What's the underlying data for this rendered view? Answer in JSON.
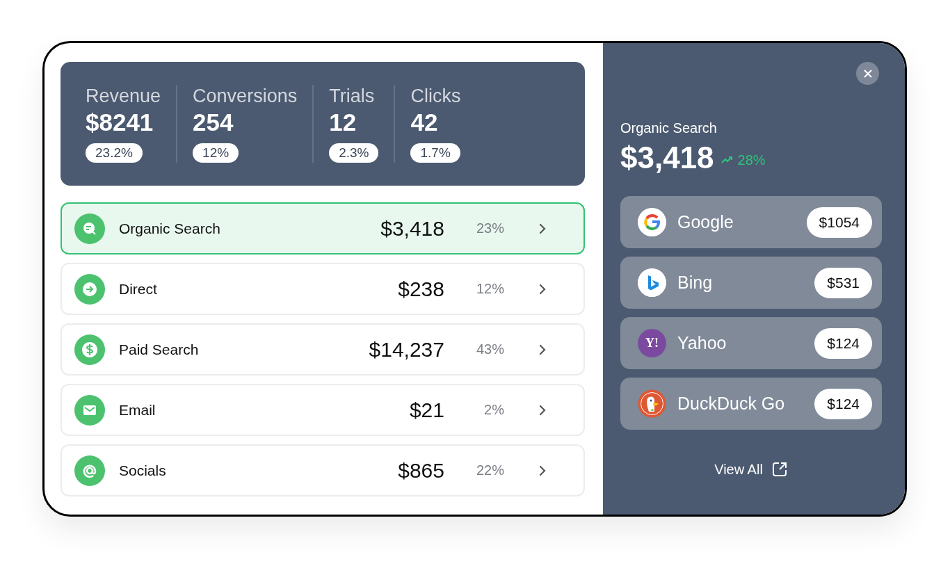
{
  "stats": [
    {
      "label": "Revenue",
      "value": "$8241",
      "change": "23.2%"
    },
    {
      "label": "Conversions",
      "value": "254",
      "change": "12%"
    },
    {
      "label": "Trials",
      "value": "12",
      "change": "2.3%"
    },
    {
      "label": "Clicks",
      "value": "42",
      "change": "1.7%"
    }
  ],
  "channels": [
    {
      "kind": "search",
      "name": "Organic Search",
      "amount": "$3,418",
      "share": "23%",
      "selected": true
    },
    {
      "kind": "direct",
      "name": "Direct",
      "amount": "$238",
      "share": "12%",
      "selected": false
    },
    {
      "kind": "dollar",
      "name": "Paid Search",
      "amount": "$14,237",
      "share": "43%",
      "selected": false
    },
    {
      "kind": "email",
      "name": "Email",
      "amount": "$21",
      "share": "2%",
      "selected": false
    },
    {
      "kind": "at",
      "name": "Socials",
      "amount": "$865",
      "share": "22%",
      "selected": false
    }
  ],
  "detail": {
    "title": "Organic Search",
    "amount": "$3,418",
    "trend": "28%",
    "sources": [
      {
        "kind": "google",
        "name": "Google",
        "amount": "$1054"
      },
      {
        "kind": "bing",
        "name": "Bing",
        "amount": "$531"
      },
      {
        "kind": "yahoo",
        "name": "Yahoo",
        "logo_text": "Y!",
        "amount": "$124"
      },
      {
        "kind": "duckduckgo",
        "name": "DuckDuck Go",
        "amount": "$124"
      }
    ],
    "link": "View All"
  }
}
